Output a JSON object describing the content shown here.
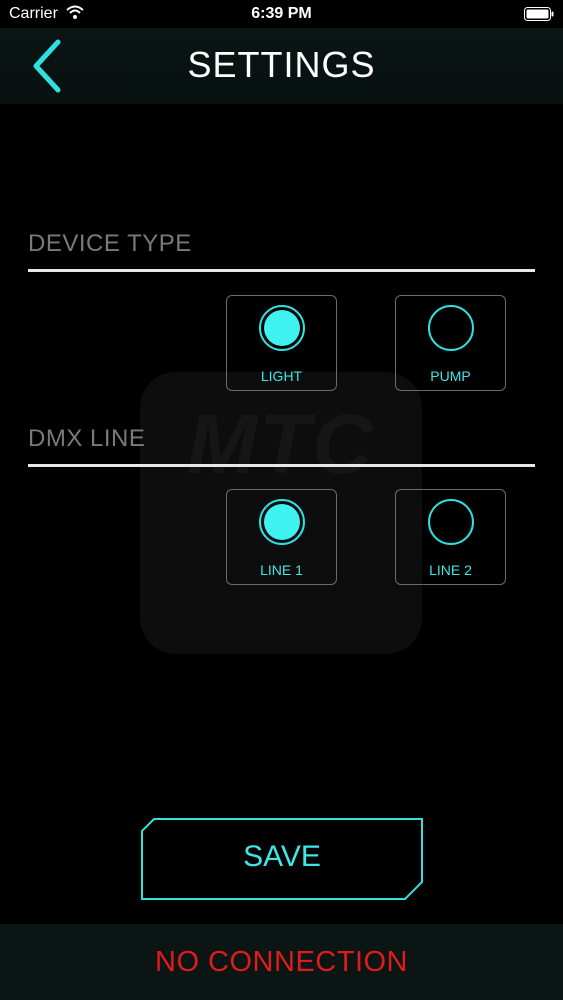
{
  "status_bar": {
    "carrier": "Carrier",
    "time": "6:39 PM",
    "wifi_icon": "wifi-icon",
    "battery_icon": "battery-icon"
  },
  "header": {
    "title": "SETTINGS",
    "back_icon": "chevron-left-icon"
  },
  "watermark": {
    "text": "MTC"
  },
  "device_type": {
    "label": "DEVICE TYPE",
    "options": [
      {
        "label": "LIGHT",
        "selected": true
      },
      {
        "label": "PUMP",
        "selected": false
      }
    ]
  },
  "dmx_line": {
    "label": "DMX LINE",
    "options": [
      {
        "label": "LINE 1",
        "selected": true
      },
      {
        "label": "LINE 2",
        "selected": false
      }
    ]
  },
  "save": {
    "label": "SAVE"
  },
  "footer": {
    "status": "NO CONNECTION"
  },
  "colors": {
    "accent": "#3fe6e6",
    "error": "#e01b1b",
    "background": "#000000"
  }
}
